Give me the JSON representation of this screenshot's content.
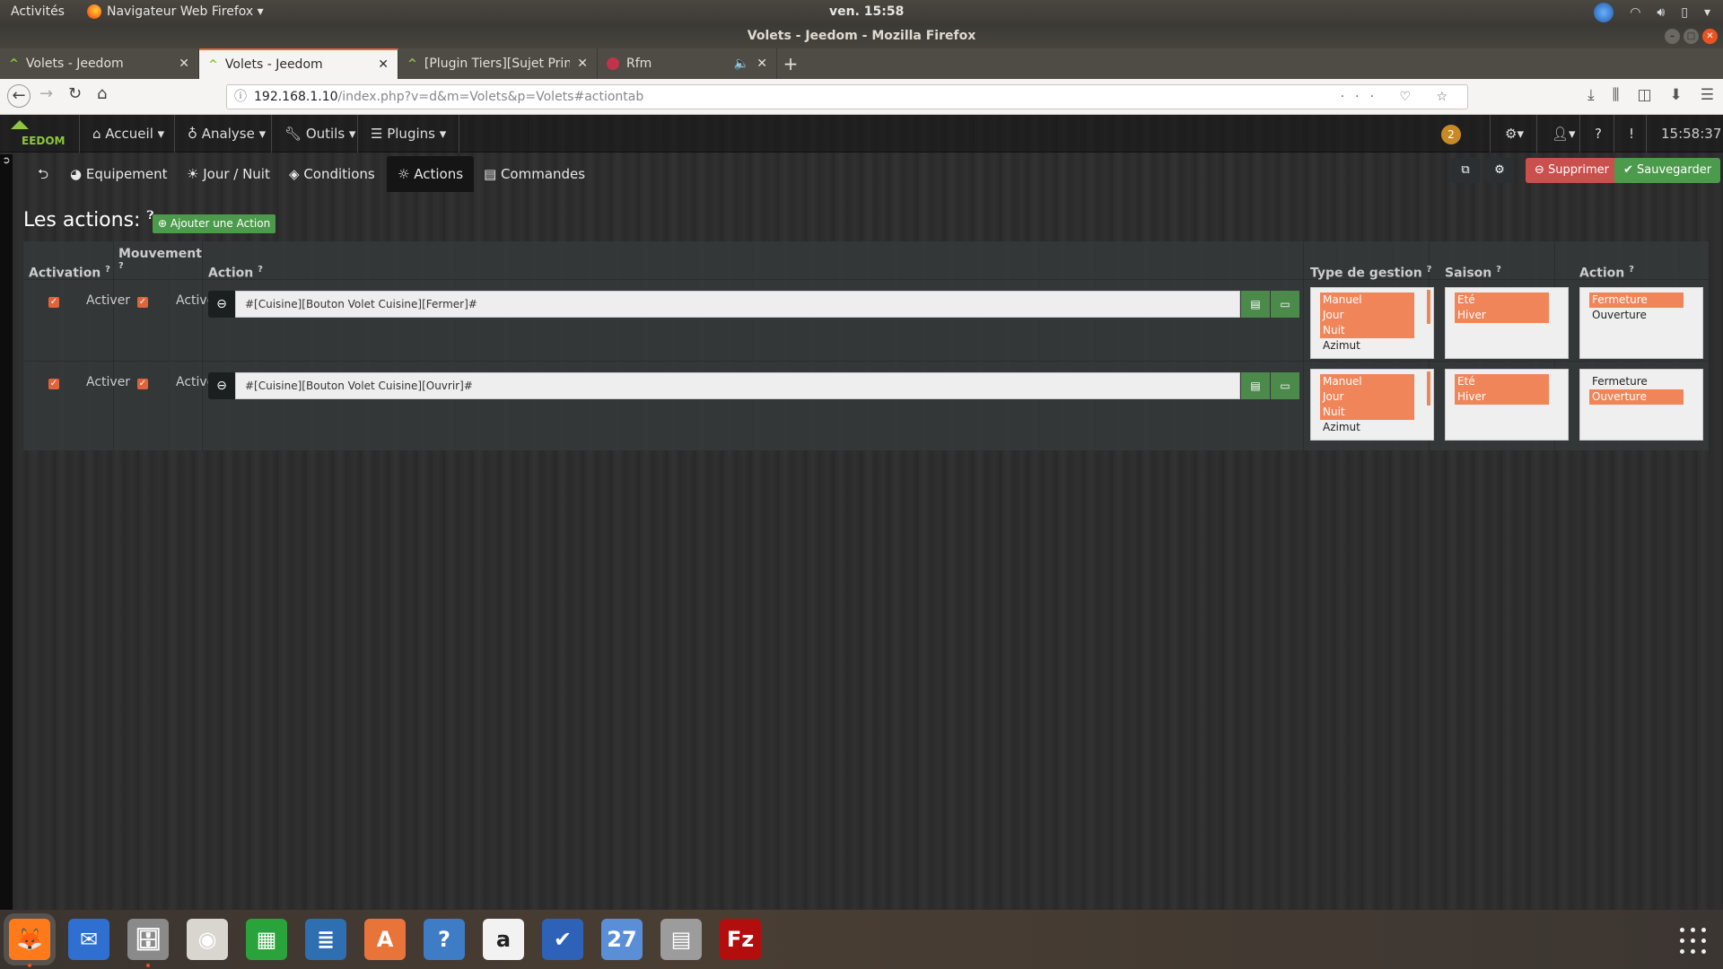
{
  "system": {
    "activities": "Activités",
    "app_menu": "Navigateur Web Firefox ▾",
    "clock": "ven. 15:58",
    "tray_icons": [
      "agent-icon",
      "wifi-icon",
      "volume-icon",
      "battery-icon",
      "menu-caret-icon"
    ]
  },
  "window": {
    "title": "Volets - Jeedom - Mozilla Firefox"
  },
  "tabs": [
    {
      "label": "Volets - Jeedom",
      "active": false
    },
    {
      "label": "Volets - Jeedom",
      "active": true
    },
    {
      "label": "[Plugin Tiers][Sujet Princ",
      "active": false
    },
    {
      "label": "Rfm",
      "active": false,
      "audio": "🔈"
    }
  ],
  "browser": {
    "url_host": "192.168.1.10",
    "url_path": "/index.php?v=d&m=Volets&p=Volets#actiontab",
    "url_right": "··· ♡ ☆"
  },
  "jeedom": {
    "logo": "EEDOM",
    "menu": [
      "Accueil ▾",
      "Analyse ▾",
      "Outils ▾",
      "Plugins ▾"
    ],
    "notif_count": "2",
    "time": "15:58:37",
    "subtabs": [
      "Equipement",
      "Jour / Nuit",
      "Conditions",
      "Actions",
      "Commandes"
    ],
    "active_subtab": "Actions",
    "delete_label": "Supprimer",
    "save_label": "Sauvegarder",
    "section_title": "Les actions:",
    "add_action_label": "Ajouter une Action",
    "columns": {
      "activation": "Activation",
      "mouvement": "Mouvement",
      "action": "Action",
      "type_gestion": "Type de gestion",
      "saison": "Saison",
      "action2": "Action"
    },
    "rows": [
      {
        "activation": "Activer",
        "mouvement": "Activer",
        "command": "#[Cuisine][Bouton Volet Cuisine][Fermer]#",
        "type_gestion": [
          {
            "label": "Manuel",
            "selected": true
          },
          {
            "label": "Jour",
            "selected": true
          },
          {
            "label": "Nuit",
            "selected": true
          },
          {
            "label": "Azimut",
            "selected": false
          }
        ],
        "saison": [
          {
            "label": "Eté",
            "selected": true
          },
          {
            "label": "Hiver",
            "selected": true
          }
        ],
        "action": [
          {
            "label": "Fermeture",
            "selected": true
          },
          {
            "label": "Ouverture",
            "selected": false
          }
        ]
      },
      {
        "activation": "Activer",
        "mouvement": "Activer",
        "command": "#[Cuisine][Bouton Volet Cuisine][Ouvrir]#",
        "type_gestion": [
          {
            "label": "Manuel",
            "selected": true
          },
          {
            "label": "Jour",
            "selected": true
          },
          {
            "label": "Nuit",
            "selected": true
          },
          {
            "label": "Azimut",
            "selected": false
          }
        ],
        "saison": [
          {
            "label": "Eté",
            "selected": true
          },
          {
            "label": "Hiver",
            "selected": true
          }
        ],
        "action": [
          {
            "label": "Fermeture",
            "selected": false
          },
          {
            "label": "Ouverture",
            "selected": true
          }
        ]
      }
    ]
  },
  "dock": [
    {
      "name": "firefox",
      "glyph": "🦊",
      "color": "#ff7a1a",
      "running": true
    },
    {
      "name": "thunderbird",
      "glyph": "✉",
      "color": "#2f6fcf",
      "running": false
    },
    {
      "name": "files",
      "glyph": "🗄",
      "color": "#8a8a8a",
      "running": true
    },
    {
      "name": "rhythmbox",
      "glyph": "◉",
      "color": "#d8d6cf",
      "running": false
    },
    {
      "name": "calc",
      "glyph": "▦",
      "color": "#2aa33b",
      "running": false
    },
    {
      "name": "writer",
      "glyph": "≣",
      "color": "#2d6fb0",
      "running": false
    },
    {
      "name": "software",
      "glyph": "A",
      "color": "#e8743a",
      "running": false
    },
    {
      "name": "help",
      "glyph": "?",
      "color": "#3e7cc6",
      "running": false
    },
    {
      "name": "amazon",
      "glyph": "a",
      "color": "#f2f2f2",
      "running": false
    },
    {
      "name": "tasks",
      "glyph": "✔",
      "color": "#2e62b8",
      "running": false
    },
    {
      "name": "calendar",
      "glyph": "27",
      "color": "#5a8fd8",
      "running": false
    },
    {
      "name": "calculator",
      "glyph": "▤",
      "color": "#9c9c9c",
      "running": false
    },
    {
      "name": "filezilla",
      "glyph": "Fz",
      "color": "#b30e0e",
      "running": false
    }
  ]
}
